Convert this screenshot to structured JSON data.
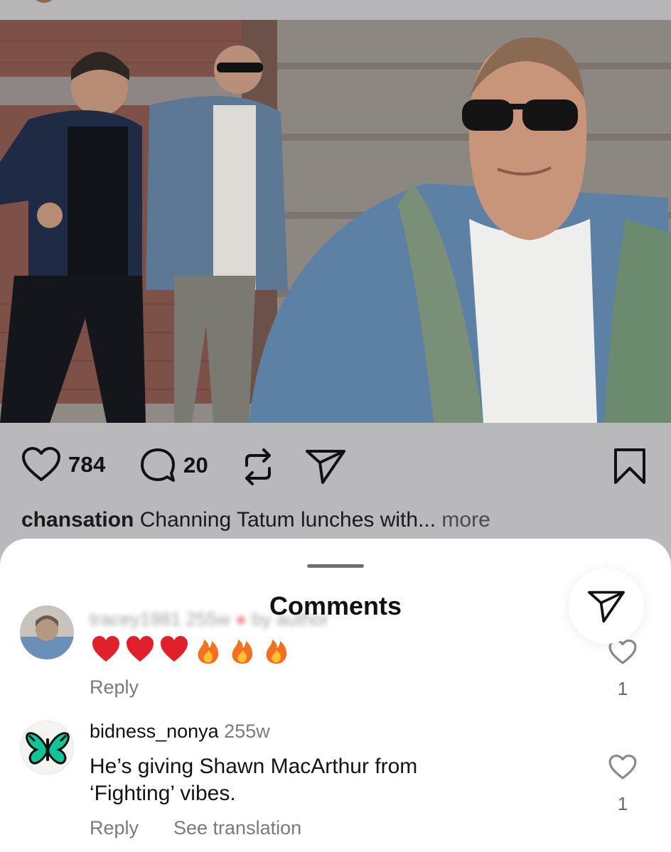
{
  "post": {
    "likes": "784",
    "comments": "20",
    "caption_user": "chansation",
    "caption_text": "Channing Tatum lunches with...",
    "caption_more": "more"
  },
  "comments_sheet": {
    "title": "Comments",
    "comments": [
      {
        "username": "tracey1981",
        "time": "255w",
        "meta_tag": "by author",
        "body_emoji": [
          "heart",
          "heart",
          "heart",
          "fire",
          "fire",
          "fire"
        ],
        "reply_label": "Reply",
        "like_count": "1"
      },
      {
        "username": "bidness_nonya",
        "time": "255w",
        "body_line1": "He’s giving Shawn MacArthur from",
        "body_line2": "‘Fighting’ vibes.",
        "reply_label": "Reply",
        "see_translation": "See translation",
        "like_count": "1"
      }
    ]
  },
  "icons": {
    "like": "heart-outline-icon",
    "comment": "speech-bubble-icon",
    "repost": "repost-icon",
    "share": "paper-plane-icon",
    "save": "bookmark-icon"
  },
  "colors": {
    "heart_red": "#e0202b",
    "fire_orange": "#f37020",
    "muted_text": "#7a7a7c",
    "butterfly_teal": "#13c49a"
  }
}
